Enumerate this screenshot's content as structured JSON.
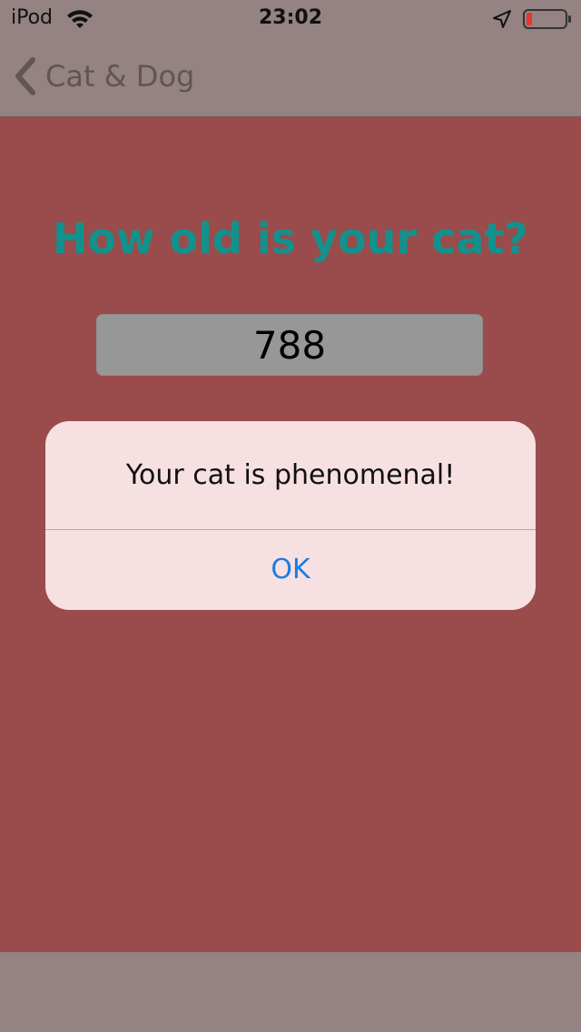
{
  "status_bar": {
    "carrier": "iPod",
    "time": "23:02",
    "icons": [
      "wifi-icon",
      "location-icon",
      "battery-icon"
    ],
    "battery_color": "#e8362f"
  },
  "nav": {
    "back_label": "Cat & Dog",
    "back_icon": "chevron-left-icon"
  },
  "main": {
    "question": "How old is your cat?",
    "age_value": "788"
  },
  "alert": {
    "message": "Your cat is phenomenal!",
    "ok_label": "OK"
  },
  "colors": {
    "background": "#9a4b4b",
    "bars": "#948382",
    "question": "#12918d",
    "alert_button": "#1a7de5"
  }
}
